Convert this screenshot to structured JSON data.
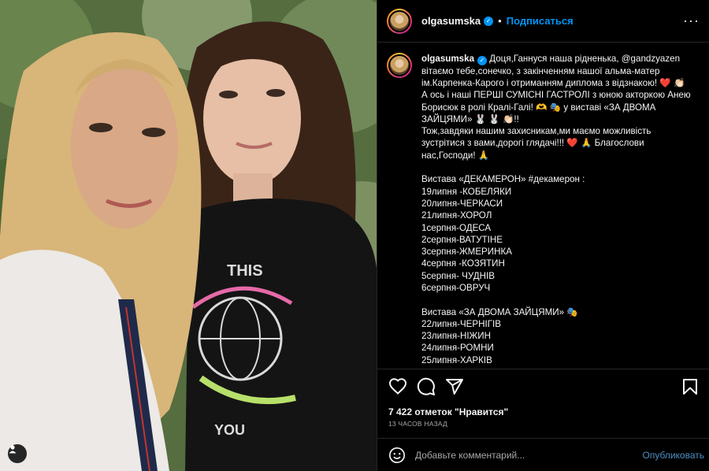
{
  "post": {
    "username": "olgasumska",
    "verified_mark": "✓",
    "dot": "•",
    "follow_label": "Подписаться",
    "more_label": "···"
  },
  "caption": {
    "username": "olgasumska",
    "text": "Доця,Ганнуся наша рідненька, @gandzyazen вітаємо тебе,сонечко, з закінченням нашої альма-матер ім.Карпенка-Карого і отриманням диплома з відзнакою! ❤️ 👏🏻\nА ось і наші ПЕРШІ СУМІСНІ ГАСТРОЛІ з юною акторкою Анею Борисюк в ролі Кралі-Галі! 🫶 🎭 у виставі «ЗА ДВОМА ЗАЙЦЯМИ» 🐰 🐰 👏🏻!!\nТож,завдяки нашим захисникам,ми маємо можливість зустрітися з вами,дорогі глядачі!!! ❤️ 🙏 Благослови нас,Господи! 🙏\n\nВистава «ДЕКАМЕРОН» #декамерон :\n19липня -КОБЕЛЯКИ\n20липня-ЧЕРКАСИ\n21липня-ХОРОЛ\n1серпня-ОДЕСА\n2серпня-ВАТУТІНЕ\n3серпня-ЖМЕРИНКА\n4серпня -КОЗЯТИН\n5серпня- ЧУДНІВ\n6серпня-ОВРУЧ\n\nВистава «ЗА ДВОМА ЗАЙЦЯМИ» 🎭\n22липня-ЧЕРНІГІВ\n23липня-НІЖИН\n24липня-РОМНИ\n25липня-ХАРКІВ"
  },
  "stats": {
    "likes": "7 422 отметок \"Нравится\"",
    "time": "13 ЧАСОВ НАЗАД"
  },
  "comment": {
    "placeholder": "Добавьте комментарий...",
    "publish_label": "Опубликовать"
  },
  "photo": {
    "shirt_top_text": "THIS",
    "shirt_bottom_text": "YOU"
  },
  "icons": {
    "like": "heart-icon",
    "comment": "comment-icon",
    "share": "share-icon",
    "save": "bookmark-icon",
    "emoji": "emoji-icon",
    "tag": "user-tag-icon"
  },
  "colors": {
    "accent": "#0095f6",
    "background": "#000000",
    "muted": "#a8a8a8"
  }
}
